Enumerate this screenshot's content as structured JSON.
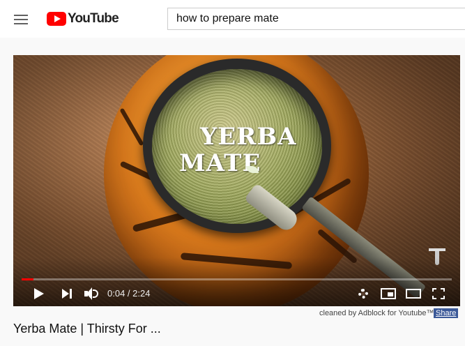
{
  "header": {
    "logo_text": "YouTube",
    "search_value": "how to prepare mate"
  },
  "player": {
    "overlay_title_line1": "YERBA",
    "overlay_title_line2": "MATE",
    "time_display": "0:04 / 2:24",
    "progress_fraction": 0.028
  },
  "footer": {
    "adblock_note": "cleaned by Adblock for Youtube™",
    "share_label": "Share",
    "video_title": "Yerba Mate | Thirsty For ..."
  },
  "colors": {
    "brand": "#ff0000",
    "progress": "#ff0000",
    "share_bg": "#3b5998"
  }
}
